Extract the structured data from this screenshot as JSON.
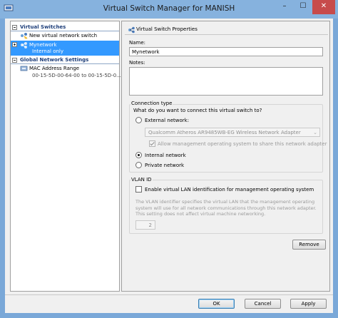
{
  "window": {
    "title": "Virtual Switch Manager for MANISH",
    "minimize": "–",
    "maximize": "☐",
    "close": "✕"
  },
  "tree": {
    "sections": [
      {
        "label": "Virtual Switches"
      },
      {
        "label": "Global Network Settings"
      }
    ],
    "items": {
      "new_switch": "New virtual network switch",
      "mynetwork": {
        "label": "Mynetwork",
        "sub": "Internal only"
      },
      "mac_range": {
        "label": "MAC Address Range",
        "sub": "00-15-5D-00-64-00 to 00-15-5D-0..."
      }
    }
  },
  "properties": {
    "header": "Virtual Switch Properties",
    "name_label": "Name:",
    "name_value": "Mynetwork",
    "notes_label": "Notes:",
    "notes_value": ""
  },
  "connection": {
    "title": "Connection type",
    "question": "What do you want to connect this virtual switch to?",
    "external_label": "External network:",
    "adapter": "Qualcomm Atheros AR9485WB-EG Wireless Network Adapter",
    "allow_mgmt": "Allow management operating system to share this network adapter",
    "internal_label": "Internal network",
    "private_label": "Private network",
    "selected": "internal"
  },
  "vlan": {
    "title": "VLAN ID",
    "enable_label": "Enable virtual LAN identification for management operating system",
    "description": "The VLAN identifier specifies the virtual LAN that the management operating system will use for all network communications through this network adapter. This setting does not affect virtual machine networking.",
    "value": "2"
  },
  "buttons": {
    "remove": "Remove",
    "ok": "OK",
    "cancel": "Cancel",
    "apply": "Apply"
  }
}
